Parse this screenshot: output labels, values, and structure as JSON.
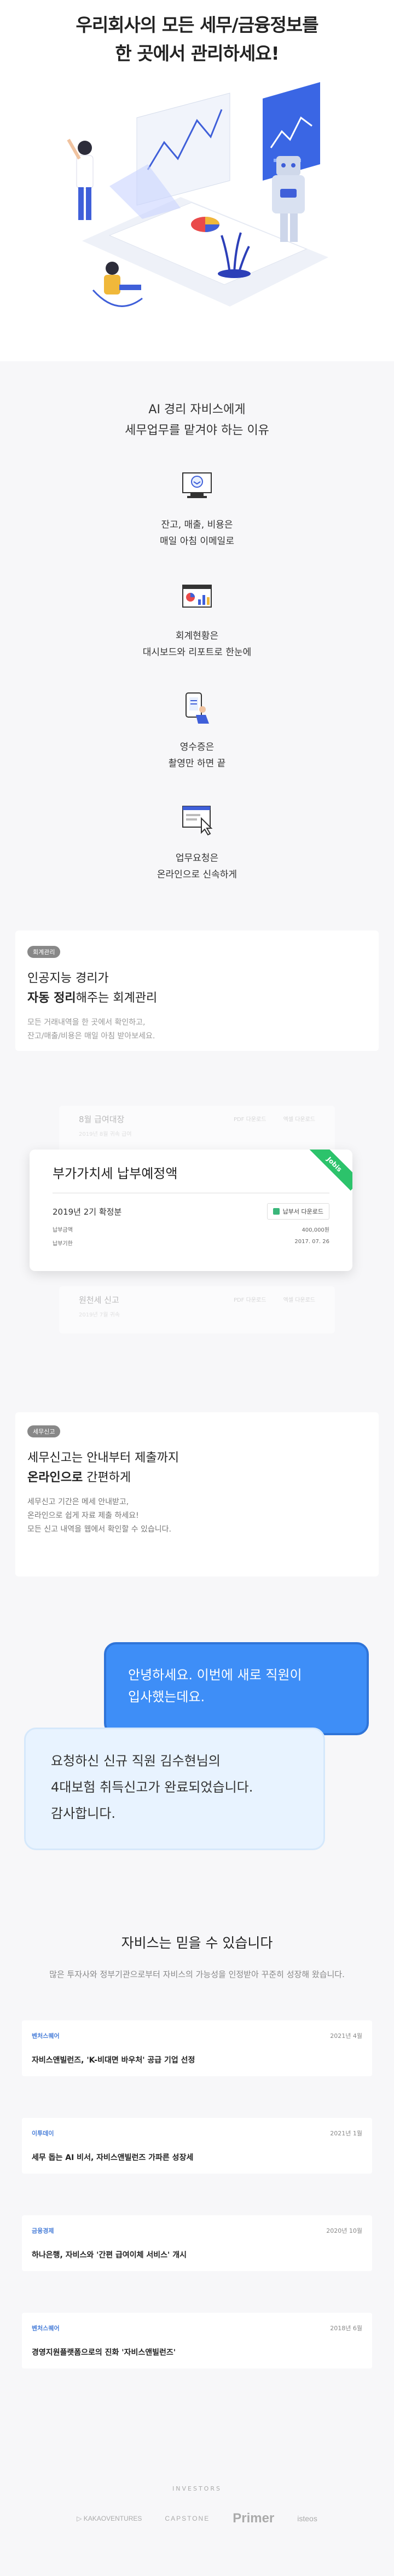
{
  "hero": {
    "line1": "우리회사의 모든 세무/금융정보를",
    "line2": "한 곳에서 관리하세요!"
  },
  "why": {
    "title_line1": "AI 경리 자비스에게",
    "title_line2": "세무업무를 맡겨야 하는 이유",
    "items": [
      {
        "icon": "monitor-mail-icon",
        "line1": "잔고, 매출, 비용은",
        "line2": "매일 아침 이메일로"
      },
      {
        "icon": "dashboard-report-icon",
        "line1": "회계현황은",
        "line2": "대시보드와 리포트로 한눈에"
      },
      {
        "icon": "receipt-phone-icon",
        "line1": "영수증은",
        "line2": "촬영만 하면 끝"
      },
      {
        "icon": "browser-click-icon",
        "line1": "업무요청은",
        "line2": "온라인으로 신속하게"
      }
    ]
  },
  "accounting": {
    "tag": "회계관리",
    "line1": "인공지능 경리가",
    "line2_bold": "자동 정리",
    "line2_rest": "해주는 회계관리",
    "desc1": "모든 거래내역을 한 곳에서 확인하고,",
    "desc2": "잔고/매출/비용은 매일 아침 받아보세요.",
    "ghost_top": {
      "title": "8월 급여대장",
      "sub": "2019년 8월 귀속 급여",
      "btn1": "PDF 다운로드",
      "btn2": "엑셀 다운로드"
    },
    "ghost_bottom": {
      "title": "원천세 신고",
      "sub": "2019년 7월 귀속",
      "btn1": "PDF 다운로드",
      "btn2": "엑셀 다운로드"
    },
    "doc": {
      "title": "부가가치세 납부예정액",
      "ribbon": "Jobis",
      "period": "2019년 2기 확정분",
      "download": "납부서 다운로드",
      "rows": [
        {
          "label": "납부금액",
          "value": "400,000원"
        },
        {
          "label": "납부기한",
          "value": "2017. 07. 26"
        }
      ]
    }
  },
  "tax": {
    "tag": "세무신고",
    "line1": "세무신고는 안내부터 제출까지",
    "line2_bold": "온라인으로",
    "line2_rest": " 간편하게",
    "desc1": "세무신고 기간은 메세 안내받고,",
    "desc2": "온라인으로 쉽게 자료 제출 하세요!",
    "desc3": "모든 신고 내역을 웹에서 확인할 수 있습니다."
  },
  "chat": {
    "user_line1": "안녕하세요. 이번에 새로 직원이",
    "user_line2": "입사했는데요.",
    "bot_line1": "요청하신 신규 직원 김수현님의",
    "bot_line2": "4대보험 취득신고가 완료되었습니다.",
    "bot_line3": "감사합니다."
  },
  "trust": {
    "title": "자비스는 믿을 수 있습니다",
    "sub": "많은 투자사와 정부기관으로부터 자비스의 가능성을 인정받아 꾸준히 성장해 왔습니다.",
    "news": [
      {
        "source": "벤처스퀘어",
        "date": "2021년 4월",
        "title": "자비스앤빌런즈, 'K-비대면 바우처' 공급 기업 선정"
      },
      {
        "source": "이투데이",
        "date": "2021년 1월",
        "title": "세무 돕는 AI 비서, 자비스앤빌런즈 가파른 성장세"
      },
      {
        "source": "금융경제",
        "date": "2020년 10월",
        "title": "하나은행, 자비스와 '간편 급여이체 서비스' 개시"
      },
      {
        "source": "벤처스퀘어",
        "date": "2018년 6월",
        "title": "경영지원플랫폼으로의 진화 '자비스앤빌런즈'"
      }
    ]
  },
  "investors": {
    "label": "INVESTORS",
    "logos": [
      "▷ KAKAOVENTURES",
      "CAPSTONE",
      "Primer",
      "isteos"
    ]
  }
}
